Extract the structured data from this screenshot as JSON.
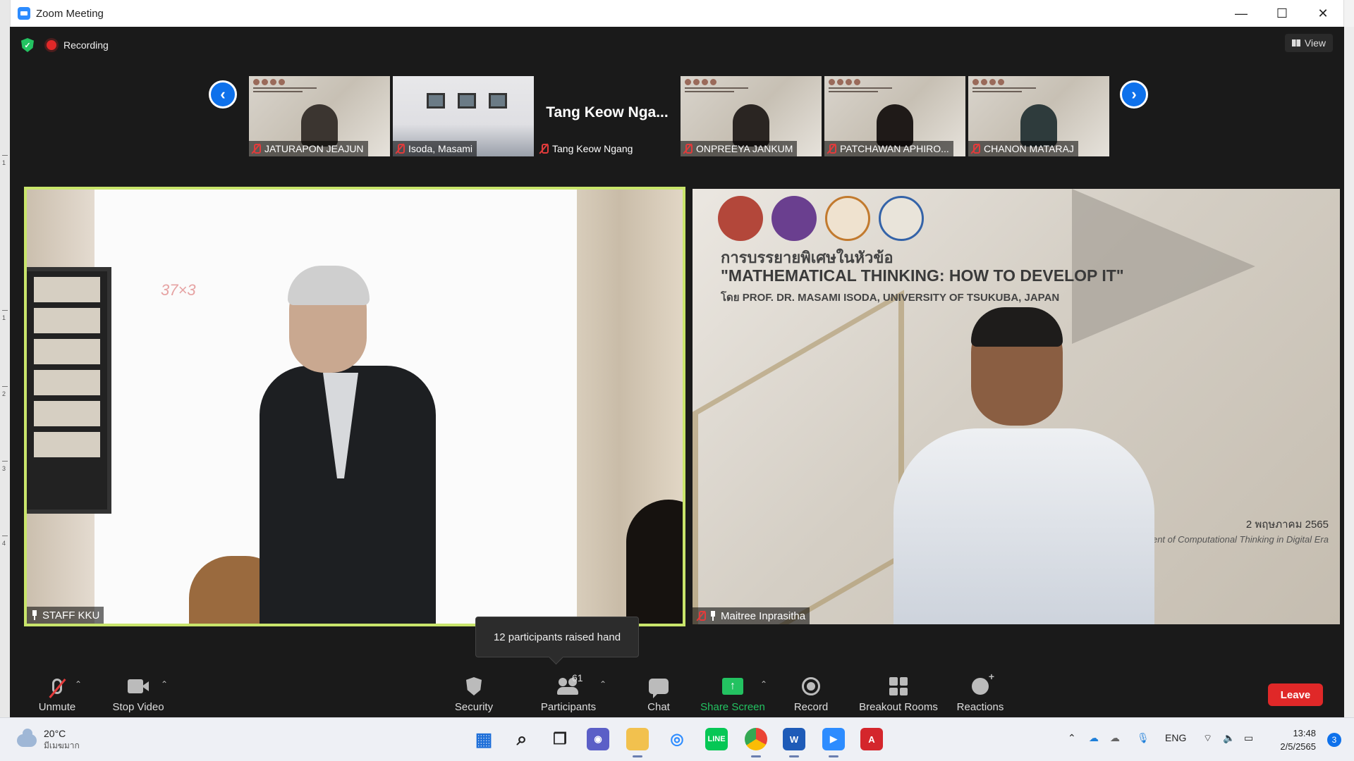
{
  "window": {
    "title": "Zoom Meeting",
    "controls": [
      "—",
      "☐",
      "✕"
    ]
  },
  "topbar": {
    "recording_label": "Recording",
    "view_label": "View"
  },
  "filmstrip": {
    "participants": [
      {
        "name": "JATURAPON JEAJUN",
        "muted": true
      },
      {
        "name": "Isoda, Masami",
        "muted": true
      },
      {
        "name": "Tang Keow Ngang",
        "display_title": "Tang Keow Nga...",
        "muted": true
      },
      {
        "name": "ONPREEYA JANKUM",
        "muted": true
      },
      {
        "name": "PATCHAWAN APHIRO...",
        "muted": true
      },
      {
        "name": "CHANON MATARAJ",
        "muted": true
      }
    ]
  },
  "main_videos": {
    "left": {
      "name": "STAFF KKU",
      "pinned": true,
      "speaking": true,
      "board_text": "37×3"
    },
    "right": {
      "name": "Maitree Inprasitha",
      "muted": true,
      "pinned": true,
      "slide_thai": "การบรรยายพิเศษในหัวข้อ",
      "slide_title": "\"MATHEMATICAL THINKING: HOW TO DEVELOP IT\"",
      "slide_byline": "โดย PROF. DR. MASAMI ISODA, UNIVERSITY OF TSUKUBA, JAPAN",
      "slide_date": "2 พฤษภาคม 2565",
      "slide_footer": "elopment of Computational Thinking in Digital Era"
    }
  },
  "tooltip": {
    "text": "12 participants raised hand"
  },
  "toolbar": {
    "unmute": "Unmute",
    "stop_video": "Stop Video",
    "security": "Security",
    "participants": "Participants",
    "participant_count": "61",
    "chat": "Chat",
    "share_screen": "Share Screen",
    "record": "Record",
    "breakout_rooms": "Breakout Rooms",
    "reactions": "Reactions",
    "leave": "Leave"
  },
  "colors": {
    "accent_blue": "#0e71eb",
    "share_green": "#23c261",
    "leave_red": "#e02828",
    "speaker_border": "#c9e56b"
  },
  "taskbar": {
    "weather_temp": "20°C",
    "weather_desc": "มีเมฆมาก",
    "language": "ENG",
    "time": "13:48",
    "date": "2/5/2565",
    "notification_count": "3",
    "apps": [
      "windows-start",
      "search",
      "task-view",
      "teams-chat",
      "file-explorer",
      "wifi-app",
      "line",
      "chrome",
      "word",
      "zoom",
      "acrobat"
    ]
  }
}
